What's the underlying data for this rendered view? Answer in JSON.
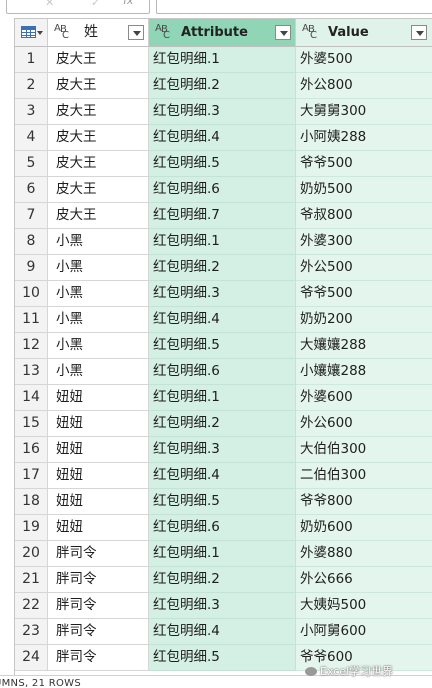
{
  "toolbar": {
    "cancel_icon": "x-icon",
    "confirm_icon": "check-icon",
    "fx_label": "fx",
    "formula_trailing": "("
  },
  "columns": {
    "row_header_icon": "table-icon",
    "xing": {
      "type_icon": "ABC",
      "label": "姓"
    },
    "attribute": {
      "type_icon": "ABC",
      "label": "Attribute"
    },
    "value": {
      "type_icon": "ABC",
      "label": "Value"
    }
  },
  "rows": [
    {
      "idx": "1",
      "xing": "皮大王",
      "attr": "红包明细.1",
      "val": "外婆500"
    },
    {
      "idx": "2",
      "xing": "皮大王",
      "attr": "红包明细.2",
      "val": "外公800"
    },
    {
      "idx": "3",
      "xing": "皮大王",
      "attr": "红包明细.3",
      "val": "大舅舅300"
    },
    {
      "idx": "4",
      "xing": "皮大王",
      "attr": "红包明细.4",
      "val": "小阿姨288"
    },
    {
      "idx": "5",
      "xing": "皮大王",
      "attr": "红包明细.5",
      "val": "爷爷500"
    },
    {
      "idx": "6",
      "xing": "皮大王",
      "attr": "红包明细.6",
      "val": "奶奶500"
    },
    {
      "idx": "7",
      "xing": "皮大王",
      "attr": "红包明细.7",
      "val": "爷叔800"
    },
    {
      "idx": "8",
      "xing": "小黑",
      "attr": "红包明细.1",
      "val": "外婆300"
    },
    {
      "idx": "9",
      "xing": "小黑",
      "attr": "红包明细.2",
      "val": "外公500"
    },
    {
      "idx": "10",
      "xing": "小黑",
      "attr": "红包明细.3",
      "val": "爷爷500"
    },
    {
      "idx": "11",
      "xing": "小黑",
      "attr": "红包明细.4",
      "val": "奶奶200"
    },
    {
      "idx": "12",
      "xing": "小黑",
      "attr": "红包明细.5",
      "val": "大孃孃288"
    },
    {
      "idx": "13",
      "xing": "小黑",
      "attr": "红包明细.6",
      "val": "小孃孃288"
    },
    {
      "idx": "14",
      "xing": "妞妞",
      "attr": "红包明细.1",
      "val": "外婆600"
    },
    {
      "idx": "15",
      "xing": "妞妞",
      "attr": "红包明细.2",
      "val": "外公600"
    },
    {
      "idx": "16",
      "xing": "妞妞",
      "attr": "红包明细.3",
      "val": "大伯伯300"
    },
    {
      "idx": "17",
      "xing": "妞妞",
      "attr": "红包明细.4",
      "val": "二伯伯300"
    },
    {
      "idx": "18",
      "xing": "妞妞",
      "attr": "红包明细.5",
      "val": "爷爷800"
    },
    {
      "idx": "19",
      "xing": "妞妞",
      "attr": "红包明细.6",
      "val": "奶奶600"
    },
    {
      "idx": "20",
      "xing": "胖司令",
      "attr": "红包明细.1",
      "val": "外婆880"
    },
    {
      "idx": "21",
      "xing": "胖司令",
      "attr": "红包明细.2",
      "val": "外公666"
    },
    {
      "idx": "22",
      "xing": "胖司令",
      "attr": "红包明细.3",
      "val": "大姨妈500"
    },
    {
      "idx": "23",
      "xing": "胖司令",
      "attr": "红包明细.4",
      "val": "小阿舅600"
    },
    {
      "idx": "24",
      "xing": "胖司令",
      "attr": "红包明细.5",
      "val": "爷爷600"
    }
  ],
  "status_bar": {
    "text": "UMNS, 21 ROWS"
  },
  "watermark": {
    "text": "Excel学习世界",
    "icon": "wechat-icon"
  },
  "colors": {
    "selected_column_header": "#8fd5b6",
    "selected_column_cells": "#d4efe3",
    "value_column_cells": "#e4f5ed",
    "row_header_bg": "#f3f3f3"
  }
}
